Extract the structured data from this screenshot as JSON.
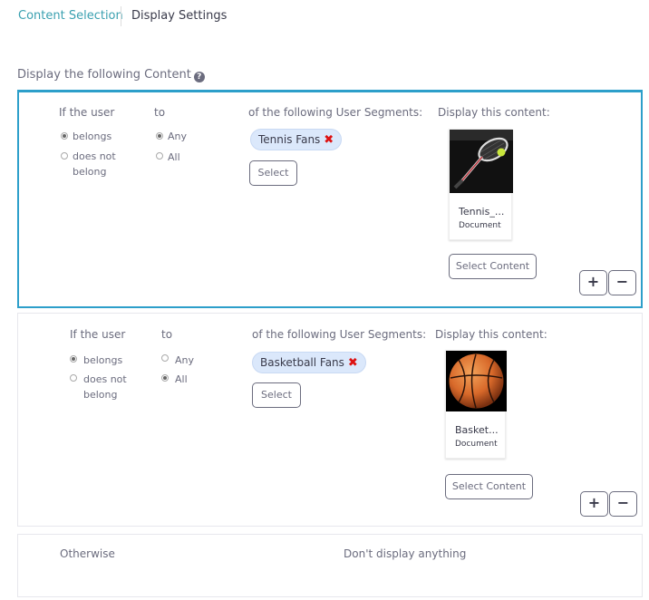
{
  "tabs": [
    {
      "label": "Content Selection",
      "active": true
    },
    {
      "label": "Display Settings",
      "active": false
    }
  ],
  "section_label": "Display the following Content",
  "help_icon": "question-circle-icon",
  "rules": [
    {
      "if_user_label": "If the user",
      "to_label": "to",
      "segments_label": "of the following User Segments:",
      "content_label": "Display this content:",
      "belongs_label": "belongs",
      "does_not_label_1": "does not",
      "does_not_label_2": "belong",
      "any_label": "Any",
      "all_label": "All",
      "selected_belongs": "belongs",
      "selected_scope": "Any",
      "segment_chip": "Tennis Fans",
      "select_button": "Select",
      "content_title": "Tennis_...",
      "content_type": "Document",
      "select_content_button": "Select Content",
      "add_button": "+",
      "remove_button": "−"
    },
    {
      "if_user_label": "If the user",
      "to_label": "to",
      "segments_label": "of the following User Segments:",
      "content_label": "Display this content:",
      "belongs_label": "belongs",
      "does_not_label_1": "does not",
      "does_not_label_2": "belong",
      "any_label": "Any",
      "all_label": "All",
      "selected_belongs": "belongs",
      "selected_scope": "All",
      "segment_chip": "Basketball Fans",
      "select_button": "Select",
      "content_title": "Basket...",
      "content_type": "Document",
      "select_content_button": "Select Content",
      "add_button": "+",
      "remove_button": "−"
    }
  ],
  "otherwise": {
    "label": "Otherwise",
    "value": "Don't display anything"
  },
  "colors": {
    "accent": "#2d9fca",
    "tab_active": "#3aa0b0",
    "chip_bg": "#dbe8fb",
    "remove_x": "#dd1111"
  }
}
